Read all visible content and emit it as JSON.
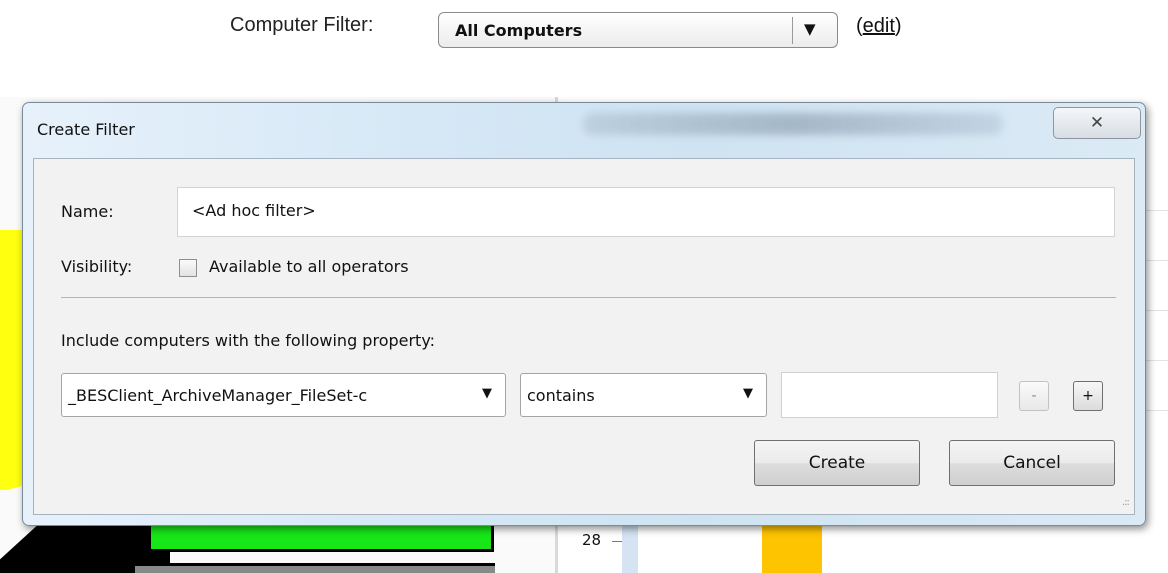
{
  "top_bar": {
    "filter_label": "Computer Filter:",
    "filter_value": "All Computers",
    "edit_link": "edit",
    "edit_prefix": "(",
    "edit_suffix": ")"
  },
  "background": {
    "tick_label": "28",
    "colors": {
      "yellow": "#ffff10",
      "green": "#17e617",
      "orange": "#ffc400"
    }
  },
  "dialog": {
    "title": "Create Filter",
    "close_icon": "close-icon",
    "name_label": "Name:",
    "name_value": "<Ad hoc filter>",
    "visibility_label": "Visibility:",
    "visibility_checkbox_label": "Available to all operators",
    "visibility_checked": false,
    "include_label": "Include computers with the following property:",
    "property_select": "_BESClient_ArchiveManager_FileSet-c",
    "operator_select": "contains",
    "value_input": "",
    "minus_label": "-",
    "plus_label": "+",
    "create_label": "Create",
    "cancel_label": "Cancel"
  }
}
